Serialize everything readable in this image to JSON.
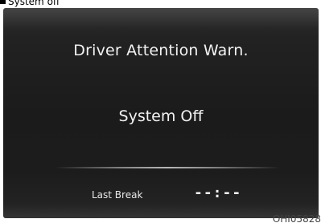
{
  "caption": {
    "text": "System off"
  },
  "display": {
    "title": "Driver Attention Warn.",
    "status": "System Off",
    "last_break_label": "Last Break",
    "last_break_value": "--:--"
  },
  "figure_code": "OHI05828"
}
